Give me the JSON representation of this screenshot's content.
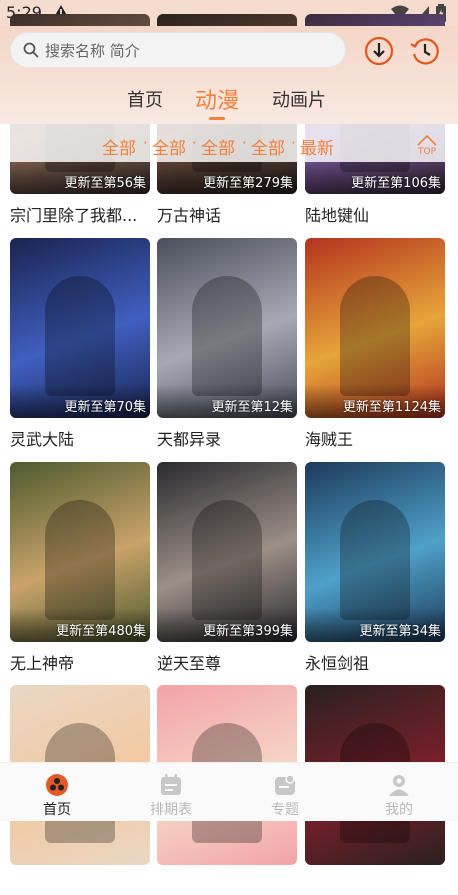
{
  "status_bar": {
    "time": "5:29"
  },
  "search": {
    "placeholder": "搜索名称 简介"
  },
  "tabs": [
    {
      "label": "首页"
    },
    {
      "label": "动漫"
    },
    {
      "label": "动画片"
    }
  ],
  "filter": {
    "items": [
      "全部",
      "全部",
      "全部",
      "全部",
      "最新"
    ],
    "top_label": "TOP"
  },
  "cards": [
    {
      "title": "宗门里除了我都...",
      "badge": "更新至第56集"
    },
    {
      "title": "万古神话",
      "badge": "更新至第279集"
    },
    {
      "title": "陆地键仙",
      "badge": "更新至第106集"
    },
    {
      "title": "灵武大陆",
      "badge": "更新至第70集"
    },
    {
      "title": "天都异录",
      "badge": "更新至第12集"
    },
    {
      "title": "海贼王",
      "badge": "更新至第1124集"
    },
    {
      "title": "无上神帝",
      "badge": "更新至第480集"
    },
    {
      "title": "逆天至尊",
      "badge": "更新至第399集"
    },
    {
      "title": "永恒剑祖",
      "badge": "更新至第34集"
    },
    {
      "title": "",
      "badge": ""
    },
    {
      "title": "",
      "badge": ""
    },
    {
      "title": "",
      "badge": ""
    }
  ],
  "bottom_nav": [
    {
      "label": "首页"
    },
    {
      "label": "排期表"
    },
    {
      "label": "专题"
    },
    {
      "label": "我的"
    }
  ],
  "colors": {
    "accent": "#f0803c",
    "header_bg": "#f6dccf"
  }
}
